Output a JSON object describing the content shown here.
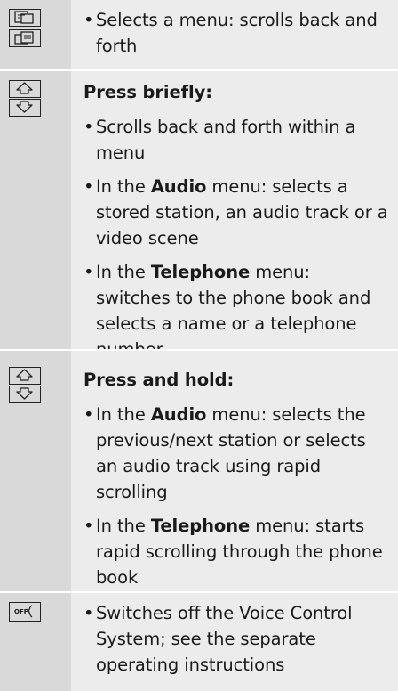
{
  "rows": [
    {
      "bullets": [
        {
          "text": "Selects a menu: scrolls back and forth"
        }
      ]
    },
    {
      "heading": "Press briefly:",
      "bullets": [
        {
          "text": "Scrolls back and forth within a menu"
        },
        {
          "pre": "In the ",
          "bold": "Audio",
          "post": " menu: selects a stored station, an audio track or a video scene"
        },
        {
          "pre": "In the ",
          "bold": "Telephone",
          "post": " menu: switches to the phone book and selects a name or a telephone number"
        }
      ]
    },
    {
      "heading": "Press and hold:",
      "bullets": [
        {
          "pre": "In the ",
          "bold": "Audio",
          "post": " menu: selects the previous/next station or selects an audio track using rapid scrolling"
        },
        {
          "pre": "In the ",
          "bold": "Telephone",
          "post": " menu: starts rapid scrolling through the phone book"
        }
      ]
    },
    {
      "off_label": "OFF",
      "bullets": [
        {
          "text": "Switches off the Voice Control System; see the separate operating instructions"
        }
      ]
    }
  ],
  "bullet_glyph": "•"
}
